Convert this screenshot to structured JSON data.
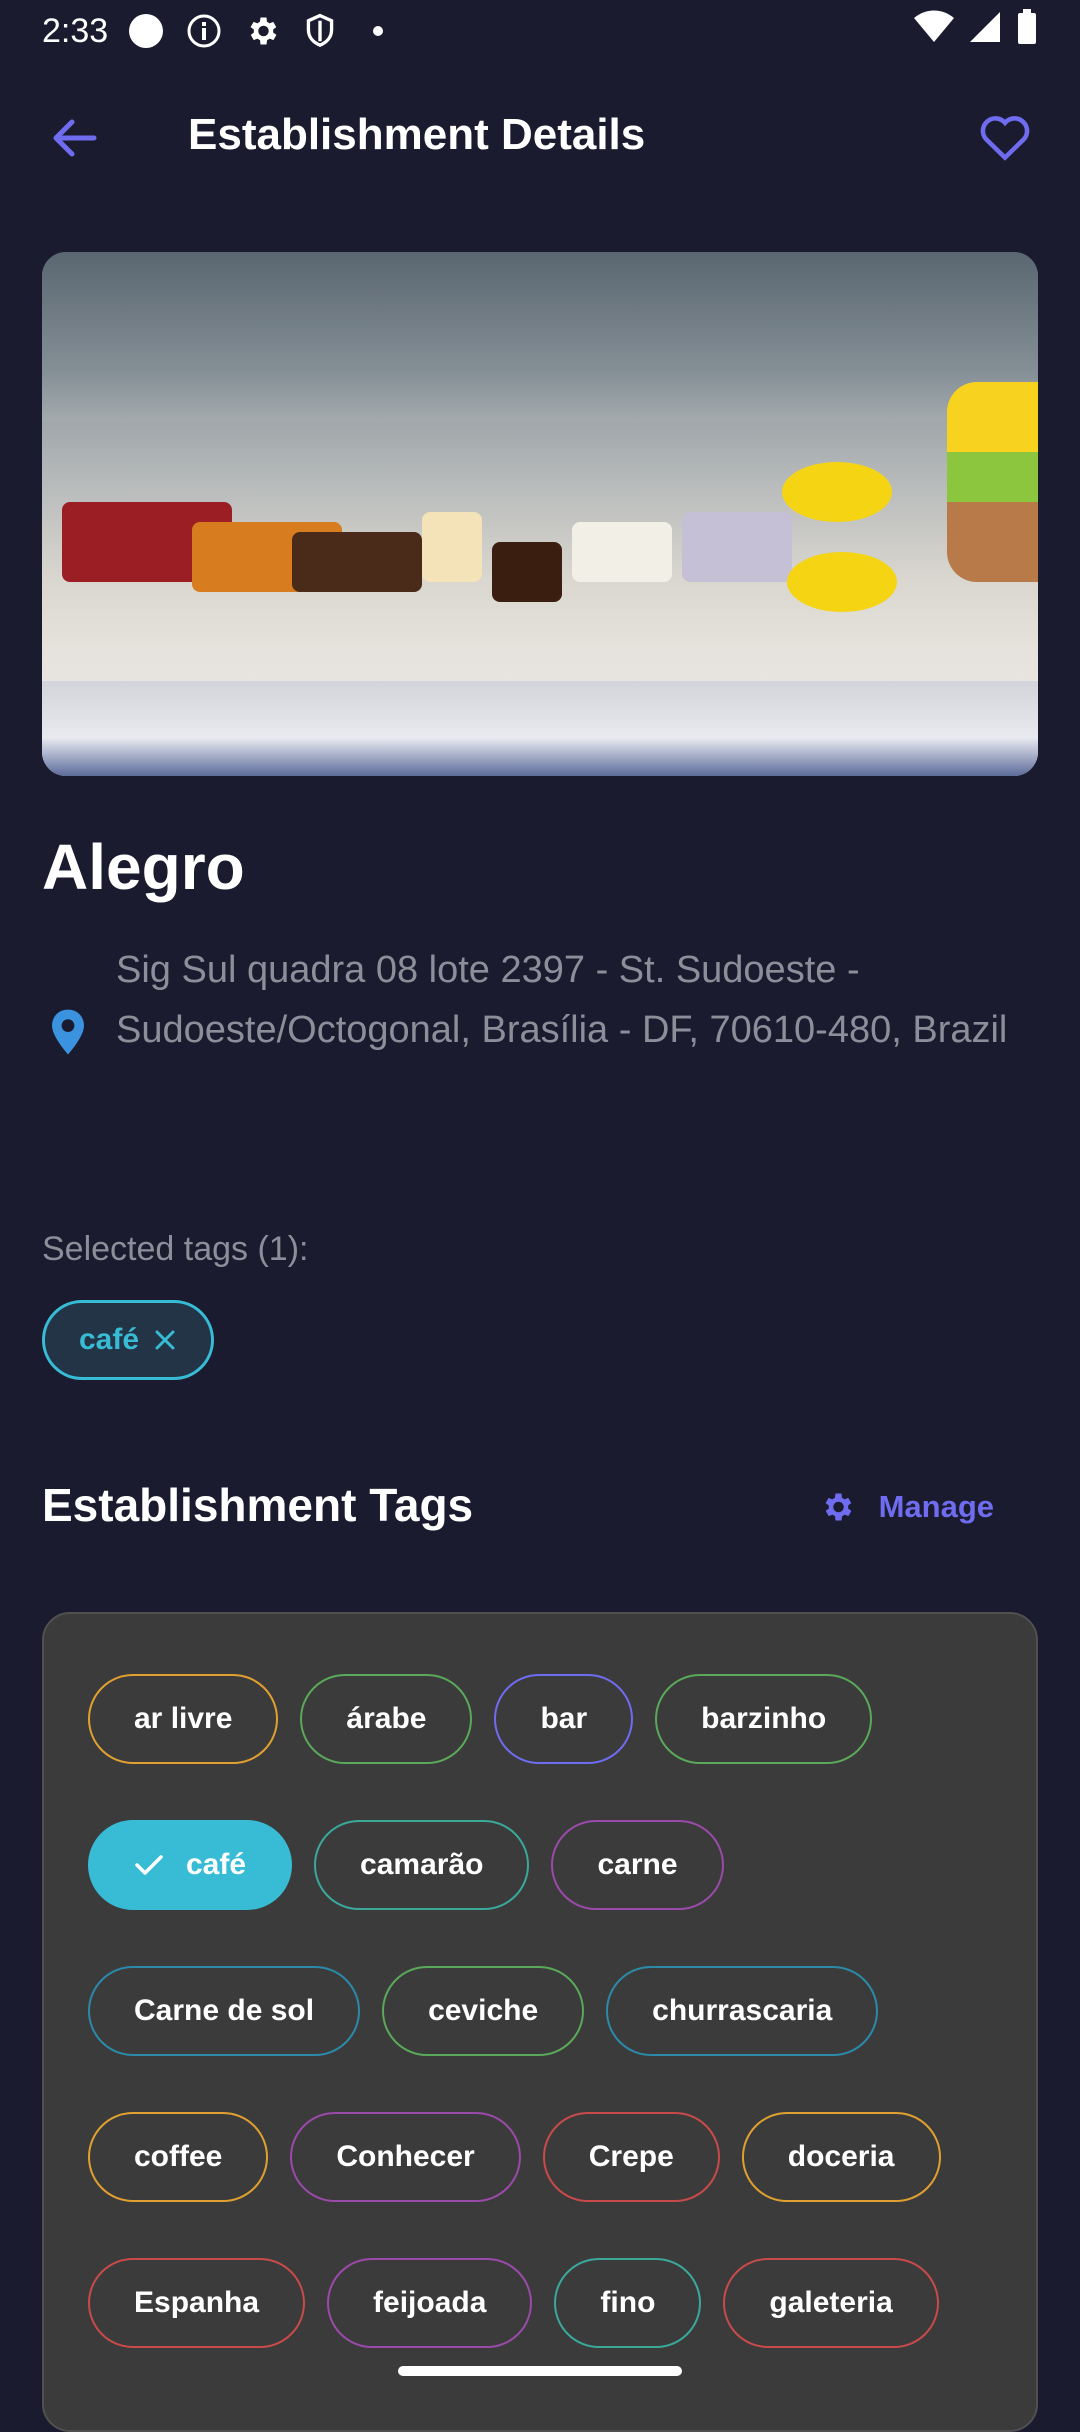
{
  "status_bar": {
    "time": "2:33",
    "icons_left": [
      "circle-icon",
      "info-icon",
      "gear-icon",
      "shield-icon",
      "dot-icon"
    ],
    "icons_right": [
      "wifi-icon",
      "signal-icon",
      "battery-icon"
    ]
  },
  "app_bar": {
    "title": "Establishment Details",
    "back_icon": "arrow-back-icon",
    "favorite_icon": "heart-outline-icon",
    "accent": "#6f6cf0"
  },
  "establishment": {
    "name": "Alegro",
    "address": "Sig Sul quadra 08 lote 2397 - St. Sudoeste - Sudoeste/Octogonal, Brasília - DF, 70610-480, Brazil",
    "photo": "pastry display case"
  },
  "selected_tags": {
    "label": "Selected tags (1):",
    "chips": [
      {
        "label": "café",
        "color": "#38bcd6"
      }
    ]
  },
  "tags_section": {
    "title": "Establishment Tags",
    "manage_label": "Manage",
    "manage_icon": "gear-icon",
    "rows": [
      [
        {
          "label": "ar livre",
          "color": "#e0a030",
          "selected": false
        },
        {
          "label": "árabe",
          "color": "#5aa85a",
          "selected": false
        },
        {
          "label": "bar",
          "color": "#6f6cf0",
          "selected": false
        },
        {
          "label": "barzinho",
          "color": "#5aa85a",
          "selected": false
        }
      ],
      [
        {
          "label": "café",
          "color": "#38bcd6",
          "selected": true
        },
        {
          "label": "camarão",
          "color": "#3aa89a",
          "selected": false
        },
        {
          "label": "carne",
          "color": "#9a4aa8",
          "selected": false
        }
      ],
      [
        {
          "label": "Carne de sol",
          "color": "#2a8aa8",
          "selected": false
        },
        {
          "label": "ceviche",
          "color": "#5aa85a",
          "selected": false
        },
        {
          "label": "churrascaria",
          "color": "#2a8aa8",
          "selected": false
        }
      ],
      [
        {
          "label": "coffee",
          "color": "#e0a030",
          "selected": false
        },
        {
          "label": "Conhecer",
          "color": "#9a4aa8",
          "selected": false
        },
        {
          "label": "Crepe",
          "color": "#c84a4a",
          "selected": false
        },
        {
          "label": "doceria",
          "color": "#e0a030",
          "selected": false
        }
      ],
      [
        {
          "label": "Espanha",
          "color": "#c84a4a",
          "selected": false
        },
        {
          "label": "feijoada",
          "color": "#9a4aa8",
          "selected": false
        },
        {
          "label": "fino",
          "color": "#3aa89a",
          "selected": false
        },
        {
          "label": "galeteria",
          "color": "#c84a4a",
          "selected": false
        }
      ]
    ]
  }
}
